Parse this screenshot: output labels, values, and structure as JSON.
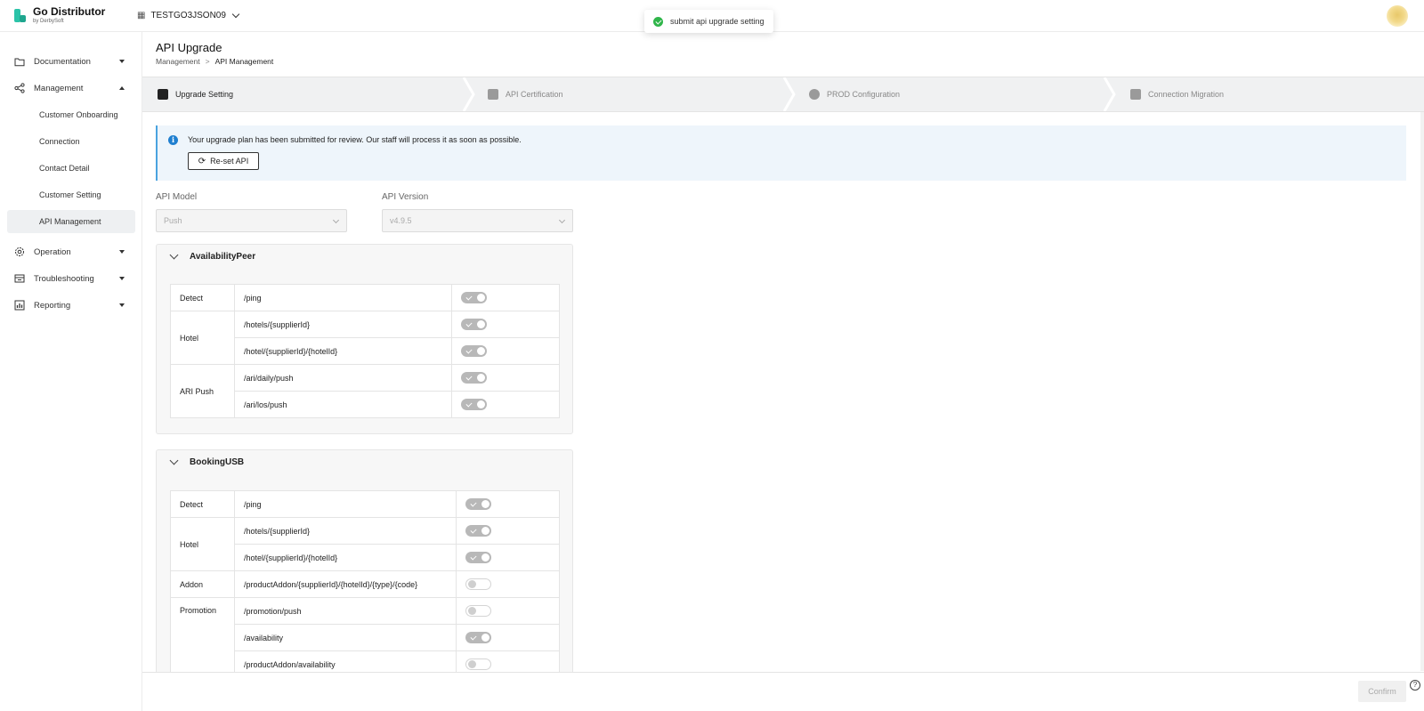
{
  "app": {
    "name": "Go Distributor",
    "by": "by DerbySoft",
    "tenant": "TESTGO3JSON09"
  },
  "toast": {
    "message": "submit api upgrade setting"
  },
  "sidebar": {
    "items": [
      {
        "label": "Documentation"
      },
      {
        "label": "Management"
      },
      {
        "label": "Operation"
      },
      {
        "label": "Troubleshooting"
      },
      {
        "label": "Reporting"
      }
    ],
    "management_sub": [
      {
        "label": "Customer Onboarding"
      },
      {
        "label": "Connection"
      },
      {
        "label": "Contact Detail"
      },
      {
        "label": "Customer Setting"
      },
      {
        "label": "API Management"
      }
    ]
  },
  "page": {
    "title": "API Upgrade",
    "breadcrumb": {
      "parent": "Management",
      "sep": ">",
      "current": "API Management"
    }
  },
  "steps": [
    {
      "label": "Upgrade Setting"
    },
    {
      "label": "API Certification"
    },
    {
      "label": "PROD Configuration"
    },
    {
      "label": "Connection Migration"
    }
  ],
  "notice": {
    "info": "i",
    "message": "Your upgrade plan has been submitted for review. Our staff will process it as soon as possible.",
    "reset_label": "Re-set API"
  },
  "form": {
    "model_label": "API Model",
    "model_value": "Push",
    "version_label": "API Version",
    "version_value": "v4.9.5"
  },
  "sections": [
    {
      "title": "AvailabilityPeer",
      "rows": [
        {
          "group": "Detect",
          "path": "/ping",
          "enabled": true
        },
        {
          "group": "Hotel",
          "path": "/hotels/{supplierId}",
          "enabled": true
        },
        {
          "group": "",
          "path": "/hotel/{supplierId}/{hotelId}",
          "enabled": true
        },
        {
          "group": "ARI Push",
          "path": "/ari/daily/push",
          "enabled": true
        },
        {
          "group": "",
          "path": "/ari/los/push",
          "enabled": true
        }
      ]
    },
    {
      "title": "BookingUSB",
      "rows": [
        {
          "group": "Detect",
          "path": "/ping",
          "enabled": true
        },
        {
          "group": "Hotel",
          "path": "/hotels/{supplierId}",
          "enabled": true
        },
        {
          "group": "",
          "path": "/hotel/{supplierId}/{hotelId}",
          "enabled": true
        },
        {
          "group": "Addon",
          "path": "/productAddon/{supplierId}/{hotelId}/{type}/{code}",
          "enabled": false
        },
        {
          "group": "Promotion",
          "path": "/promotion/push",
          "enabled": false
        },
        {
          "group": "",
          "path": "/availability",
          "enabled": true
        },
        {
          "group": "",
          "path": "/productAddon/availability",
          "enabled": false
        }
      ]
    }
  ],
  "footer": {
    "confirm_label": "Confirm",
    "help": "?"
  }
}
